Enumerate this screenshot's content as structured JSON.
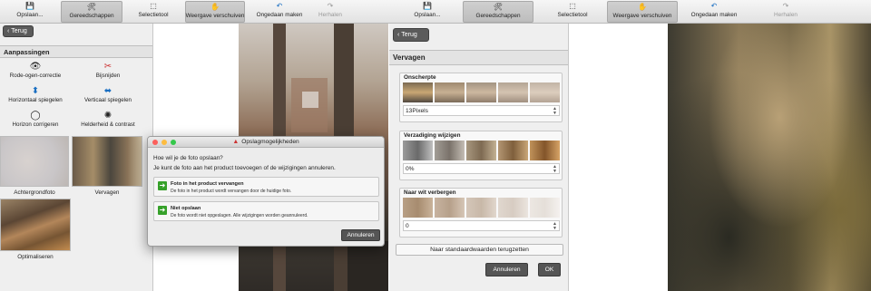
{
  "left_toolbar": {
    "save": "Opslaan...",
    "tools": "Gereedschappen",
    "select_tool": "Selectietool",
    "move_view": "Weergave verschuiven",
    "undo": "Ongedaan maken",
    "redo": "Herhalen"
  },
  "right_toolbar": {
    "save": "Opslaan...",
    "tools": "Gereedschappen",
    "select_tool": "Selectietool",
    "move_view": "Weergave verschuiven",
    "undo": "Ongedaan maken",
    "redo": "Herhalen"
  },
  "left_panel": {
    "back": "Terug",
    "section": "Aanpassingen",
    "adjustments": [
      {
        "label": "Rode-ogen-correctie",
        "icon": "red-eye-icon"
      },
      {
        "label": "Bijsnijden",
        "icon": "crop-icon"
      },
      {
        "label": "Horizontaal spiegelen",
        "icon": "flip-horizontal-icon"
      },
      {
        "label": "Verticaal spiegelen",
        "icon": "flip-vertical-icon"
      },
      {
        "label": "Horizon corrigeren",
        "icon": "horizon-icon"
      },
      {
        "label": "Helderheid & contrast",
        "icon": "brightness-icon"
      }
    ],
    "thumbnails": [
      {
        "label": "Achtergrondfoto"
      },
      {
        "label": "Vervagen"
      },
      {
        "label": "Optimaliseren"
      }
    ]
  },
  "dialog": {
    "title": "Opslagmogelijkheden",
    "question": "Hoe wil je de foto opslaan?",
    "info": "Je kunt de foto aan het product toevoegen of de wijzigingen annuleren.",
    "option1_title": "Foto in het product vervangen",
    "option1_desc": "De foto in het product wordt vervangen door de huidige foto.",
    "option2_title": "Niet opslaan",
    "option2_desc": "De foto wordt niet opgeslagen. Alle wijzigingen worden geannuleerd.",
    "cancel": "Annuleren"
  },
  "right_panel": {
    "back": "Terug",
    "section": "Vervagen",
    "blur_label": "Onscherpte",
    "blur_value": "13Pixels",
    "fade_label": "Verzadiging wijzigen",
    "fade_value": "0%",
    "hide_label": "Naar wit verbergen",
    "hide_value": "0",
    "reset": "Naar standaardwaarden terugzetten",
    "cancel": "Annuleren",
    "ok": "OK"
  },
  "colors": {
    "accent_blue": "#1a6fc2",
    "panel_bg": "#efefef",
    "button_dark": "#555555",
    "ok_green": "#36a12a"
  }
}
